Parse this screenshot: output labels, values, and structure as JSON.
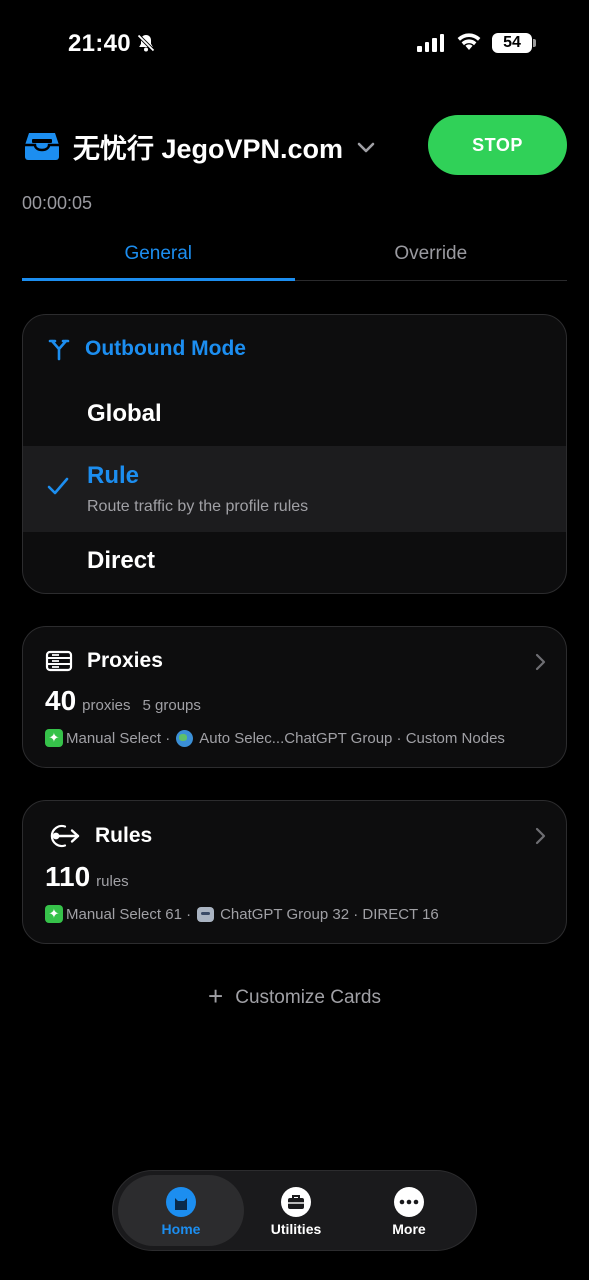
{
  "status_bar": {
    "time": "21:40",
    "battery": "54"
  },
  "header": {
    "profile_name": "无忧行 JegoVPN.com",
    "stop_label": "STOP",
    "timer": "00:00:05"
  },
  "tabs": [
    {
      "label": "General",
      "active": true
    },
    {
      "label": "Override",
      "active": false
    }
  ],
  "outbound": {
    "title": "Outbound Mode",
    "options": [
      {
        "label": "Global",
        "selected": false
      },
      {
        "label": "Rule",
        "selected": true,
        "description": "Route traffic by the profile rules"
      },
      {
        "label": "Direct",
        "selected": false
      }
    ]
  },
  "proxies": {
    "title": "Proxies",
    "count": "40",
    "count_unit": "proxies",
    "groups": "5 groups",
    "summary_a": "Manual Select ·",
    "summary_b": "Auto Selec...ChatGPT Group · Custom Nodes"
  },
  "rules": {
    "title": "Rules",
    "count": "110",
    "count_unit": "rules",
    "summary_a": "Manual Select 61 ·",
    "summary_b": "ChatGPT Group 32 · DIRECT 16"
  },
  "customize": {
    "label": "Customize Cards"
  },
  "tabbar": {
    "home": "Home",
    "utilities": "Utilities",
    "more": "More"
  },
  "colors": {
    "accent": "#1c8ef0",
    "stop": "#30d158",
    "background": "#000000"
  },
  "icons": [
    "bell-slash-icon",
    "signal-icon",
    "wifi-icon",
    "battery-icon",
    "profile-tray-icon",
    "chevron-down-icon",
    "branch-icon",
    "checkmark-icon",
    "server-icon",
    "route-icon",
    "chevron-right-icon",
    "plus-icon",
    "home-cat-icon",
    "briefcase-icon",
    "ellipsis-icon"
  ]
}
